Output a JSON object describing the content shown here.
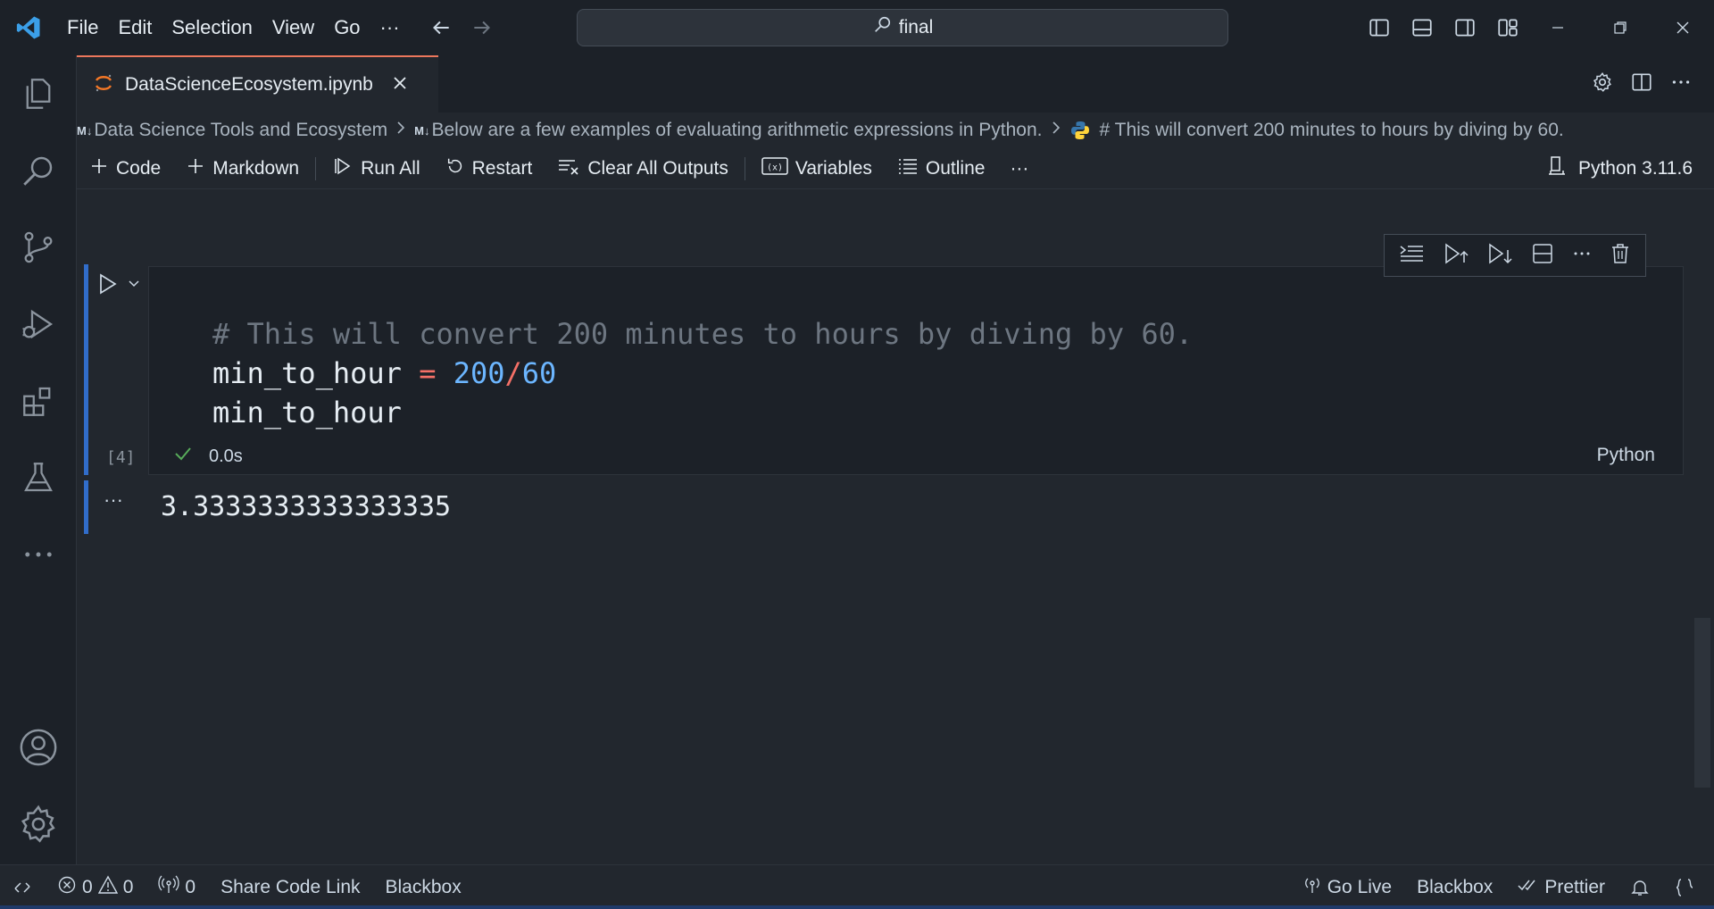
{
  "menu": [
    "File",
    "Edit",
    "Selection",
    "View",
    "Go",
    "···"
  ],
  "search": {
    "text": "final"
  },
  "tab": {
    "filename": "DataScienceEcosystem.ipynb"
  },
  "breadcrumb": {
    "md_tag": "M↓",
    "item1": "Data Science Tools and Ecosystem",
    "item2": "Below are a few examples of evaluating arithmetic expressions in Python.",
    "item3": "# This will convert 200 minutes to hours by diving by 60."
  },
  "toolbar": {
    "code": "Code",
    "markdown": "Markdown",
    "run_all": "Run All",
    "restart": "Restart",
    "clear_outputs": "Clear All Outputs",
    "variables": "Variables",
    "outline": "Outline",
    "more": "···",
    "kernel": "Python 3.11.6"
  },
  "cell": {
    "code_line1": "# This will convert 200 minutes to hours by diving by 60.",
    "code_line2_var": "min_to_hour",
    "code_line2_op1": " = ",
    "code_line2_num1": "200",
    "code_line2_op2": "/",
    "code_line2_num2": "60",
    "code_line3": "min_to_hour",
    "exec_count": "[4]",
    "exec_time": "0.0s",
    "language": "Python",
    "output_prefix": "···",
    "output": "3.3333333333333335"
  },
  "status": {
    "errors": "0",
    "warnings": "0",
    "ports": "0",
    "share": "Share Code Link",
    "blackbox_left": "Blackbox",
    "go_live": "Go Live",
    "blackbox_right": "Blackbox",
    "prettier": "Prettier"
  },
  "colors": {
    "accent": "#316dca",
    "tab_active_border": "#ec775c",
    "success": "#57ab5a"
  }
}
